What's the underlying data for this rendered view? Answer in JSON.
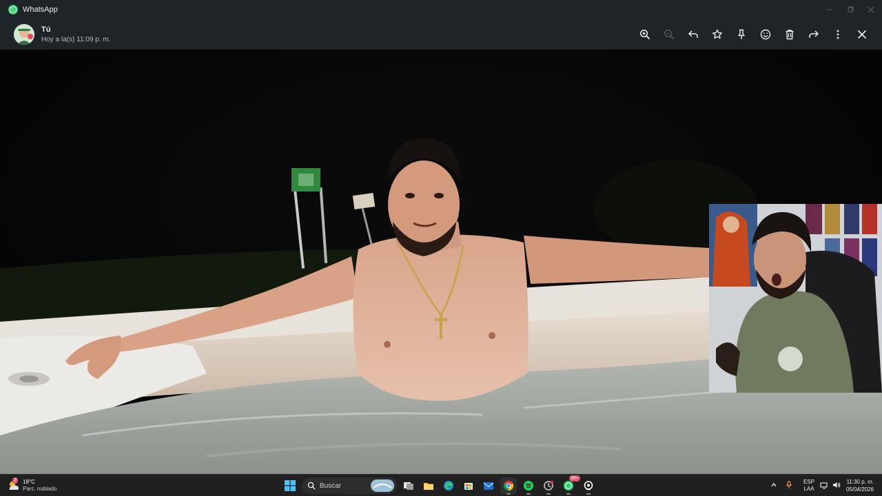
{
  "window": {
    "app_title": "WhatsApp"
  },
  "viewer": {
    "sender_name": "Tú",
    "timestamp": "Hoy a la(s) 11:09 p. m.",
    "tools": [
      {
        "name": "zoom-in-icon",
        "enabled": true
      },
      {
        "name": "zoom-out-icon",
        "enabled": false
      },
      {
        "name": "reply-icon",
        "enabled": true
      },
      {
        "name": "star-icon",
        "enabled": true
      },
      {
        "name": "pin-icon",
        "enabled": true
      },
      {
        "name": "emoji-icon",
        "enabled": true
      },
      {
        "name": "delete-icon",
        "enabled": true
      },
      {
        "name": "forward-icon",
        "enabled": true
      },
      {
        "name": "more-icon",
        "enabled": true
      },
      {
        "name": "close-icon",
        "enabled": true
      }
    ]
  },
  "taskbar": {
    "weather_temp": "18°C",
    "weather_condition": "Parc. nublado",
    "weather_alert_count": "2",
    "search_label": "Buscar",
    "whatsapp_badge": "99+",
    "lang_primary": "ESP",
    "lang_secondary": "LAA",
    "time": "11:30 p. m.",
    "date": "05/04/2026"
  },
  "colors": {
    "whatsapp_green": "#25d366",
    "bar_bg": "#1f2428",
    "taskbar_bg": "#202020"
  }
}
